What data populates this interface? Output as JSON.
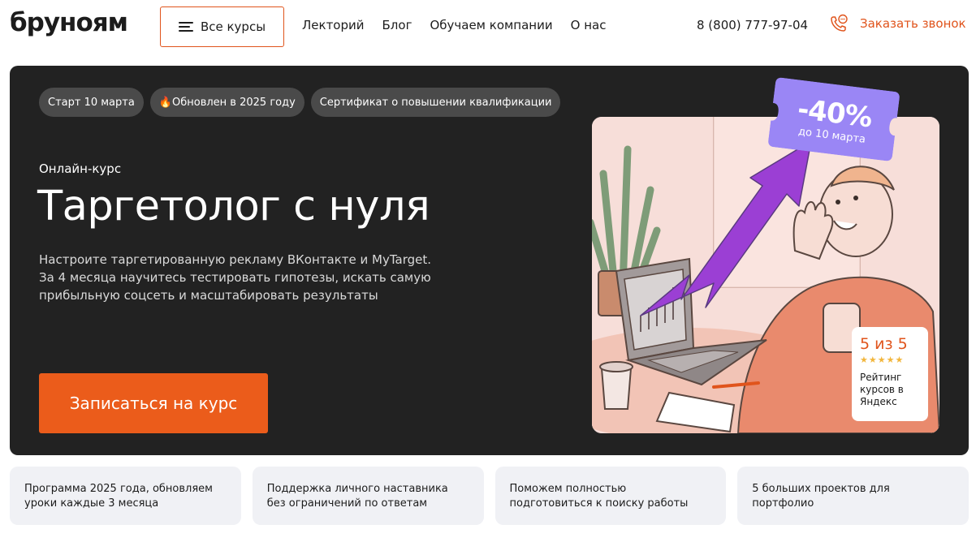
{
  "header": {
    "logo": "бруноям",
    "all_courses_label": "Все курсы",
    "nav": [
      "Лекторий",
      "Блог",
      "Обучаем компании",
      "О нас"
    ],
    "phone": "8 (800) 777-97-04",
    "callback_label": "Заказать звонок"
  },
  "hero": {
    "tags": [
      "Старт 10 марта",
      "🔥Обновлен в 2025 году",
      "Сертификат о повышении квалификации"
    ],
    "kicker": "Онлайн-курс",
    "title": "Таргетолог с нуля",
    "description": "Настроите таргетированную рекламу ВКонтакте и MyTarget. За 4 месяца научитесь тестировать гипотезы, искать самую прибыльную соцсеть и масштабировать результаты",
    "cta_label": "Записаться на курс",
    "discount": {
      "percent": "-40%",
      "until": "до 10 марта"
    },
    "rating": {
      "score": "5 из 5",
      "stars": 5,
      "label": "Рейтинг курсов в Яндекс"
    }
  },
  "features": [
    "Программа 2025 года, обновляем уроки каждые 3 месяца",
    "Поддержка личного наставника без ограничений по ответам",
    "Поможем полностью подготовиться к поиску работы",
    "5 больших проектов для портфолио"
  ],
  "colors": {
    "accent": "#eb5c1b",
    "hero_bg": "#222222",
    "tag_bg": "#4a4a4a",
    "discount_bg": "#9a86f5",
    "feature_bg": "#f0f1f5"
  }
}
